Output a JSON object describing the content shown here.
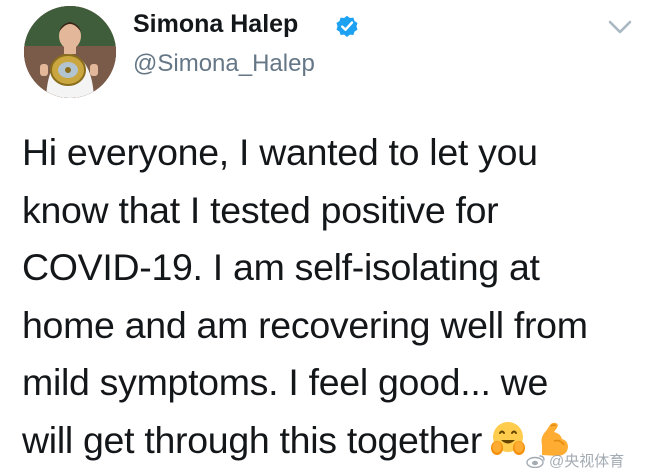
{
  "author": {
    "display_name": "Simona Halep",
    "handle": "@Simona_Halep",
    "verified": true
  },
  "icons": {
    "verified": "verified-badge-icon",
    "more": "chevron-down-icon",
    "emoji_1": "hugging-face-emoji",
    "emoji_2": "flexed-biceps-emoji"
  },
  "tweet": {
    "lines": [
      "Hi everyone, I wanted to let you",
      "know that I tested positive for",
      "COVID-19. I am self-isolating at",
      "home and am recovering well from",
      "mild symptoms. I feel good... we",
      "will get through this together"
    ]
  },
  "watermark": {
    "text": "@央视体育"
  },
  "colors": {
    "text": "#14171a",
    "secondary": "#657786",
    "verified_blue": "#1da1f2",
    "caret": "#aab8c2"
  }
}
